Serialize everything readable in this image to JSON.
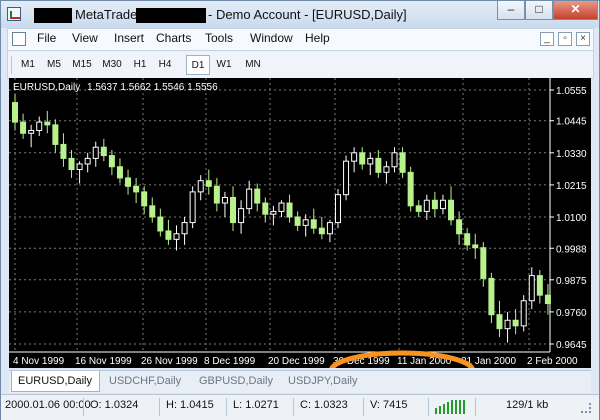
{
  "window": {
    "title": "MetaTrader",
    "subtitle": "- Demo Account - [EURUSD,Daily]",
    "controls": [
      "–",
      "□",
      "✕"
    ]
  },
  "menu": [
    "File",
    "View",
    "Insert",
    "Charts",
    "Tools",
    "Window",
    "Help"
  ],
  "mdi_controls": [
    "_",
    "▫",
    "×"
  ],
  "toolbar": {
    "timeframes": [
      "M1",
      "M5",
      "M15",
      "M30",
      "H1",
      "H4",
      "D1",
      "W1",
      "MN"
    ],
    "active": "D1"
  },
  "chart": {
    "symbol_label": "EURUSD,Daily",
    "ohlc": "1.5637 1.5662 1.5546 1.5556",
    "price_axis": [
      "1.0555",
      "1.0445",
      "1.0330",
      "1.0215",
      "1.0100",
      "0.9988",
      "0.9875",
      "0.9760",
      "0.9645"
    ],
    "date_axis": [
      "4 Nov 1999",
      "16 Nov 1999",
      "26 Nov 1999",
      "8 Dec 1999",
      "20 Dec 1999",
      "30 Dec 1999",
      "11 Jan 2000",
      "21 Jan 2000",
      "2 Feb 2000"
    ],
    "colors": {
      "background": "#000000",
      "bull": "#ffffff",
      "bear": "#b7f28d",
      "grid": "#7a7a7a",
      "highlight": "#f7931e"
    }
  },
  "chart_data": {
    "type": "candlestick",
    "y_axis_range": [
      0.9645,
      1.0555
    ],
    "x": [
      "4 Nov 1999",
      "16 Nov 1999",
      "26 Nov 1999",
      "8 Dec 1999",
      "20 Dec 1999",
      "30 Dec 1999",
      "11 Jan 2000",
      "21 Jan 2000",
      "2 Feb 2000"
    ],
    "candles": [
      [
        1.051,
        1.054,
        1.041,
        1.044
      ],
      [
        1.044,
        1.047,
        1.038,
        1.04
      ],
      [
        1.04,
        1.043,
        1.035,
        1.041
      ],
      [
        1.041,
        1.046,
        1.039,
        1.044
      ],
      [
        1.044,
        1.048,
        1.04,
        1.043
      ],
      [
        1.043,
        1.045,
        1.033,
        1.036
      ],
      [
        1.036,
        1.04,
        1.028,
        1.031
      ],
      [
        1.031,
        1.034,
        1.024,
        1.027
      ],
      [
        1.027,
        1.03,
        1.022,
        1.029
      ],
      [
        1.029,
        1.033,
        1.026,
        1.031
      ],
      [
        1.031,
        1.037,
        1.028,
        1.035
      ],
      [
        1.035,
        1.038,
        1.03,
        1.032
      ],
      [
        1.032,
        1.034,
        1.025,
        1.028
      ],
      [
        1.028,
        1.031,
        1.022,
        1.024
      ],
      [
        1.024,
        1.027,
        1.018,
        1.021
      ],
      [
        1.021,
        1.024,
        1.015,
        1.019
      ],
      [
        1.019,
        1.021,
        1.011,
        1.014
      ],
      [
        1.014,
        1.017,
        1.008,
        1.01
      ],
      [
        1.01,
        1.013,
        1.003,
        1.005
      ],
      [
        1.005,
        1.009,
        1.0,
        1.002
      ],
      [
        1.002,
        1.007,
        0.998,
        1.004
      ],
      [
        1.004,
        1.01,
        1.0,
        1.008
      ],
      [
        1.008,
        1.021,
        1.006,
        1.019
      ],
      [
        1.019,
        1.025,
        1.016,
        1.023
      ],
      [
        1.023,
        1.027,
        1.018,
        1.021
      ],
      [
        1.021,
        1.024,
        1.012,
        1.015
      ],
      [
        1.015,
        1.019,
        1.01,
        1.017
      ],
      [
        1.017,
        1.021,
        1.005,
        1.008
      ],
      [
        1.008,
        1.016,
        1.004,
        1.013
      ],
      [
        1.013,
        1.023,
        1.011,
        1.02
      ],
      [
        1.02,
        1.022,
        1.012,
        1.015
      ],
      [
        1.015,
        1.017,
        1.008,
        1.011
      ],
      [
        1.011,
        1.014,
        1.007,
        1.012
      ],
      [
        1.012,
        1.016,
        1.01,
        1.015
      ],
      [
        1.015,
        1.018,
        1.008,
        1.01
      ],
      [
        1.01,
        1.012,
        1.005,
        1.007
      ],
      [
        1.007,
        1.011,
        1.003,
        1.009
      ],
      [
        1.009,
        1.013,
        1.004,
        1.006
      ],
      [
        1.006,
        1.01,
        1.002,
        1.004
      ],
      [
        1.004,
        1.009,
        1.001,
        1.008
      ],
      [
        1.008,
        1.02,
        1.006,
        1.018
      ],
      [
        1.018,
        1.032,
        1.016,
        1.03
      ],
      [
        1.03,
        1.035,
        1.026,
        1.033
      ],
      [
        1.033,
        1.035,
        1.027,
        1.029
      ],
      [
        1.029,
        1.033,
        1.025,
        1.031
      ],
      [
        1.031,
        1.034,
        1.024,
        1.026
      ],
      [
        1.026,
        1.03,
        1.022,
        1.028
      ],
      [
        1.028,
        1.035,
        1.026,
        1.033
      ],
      [
        1.033,
        1.035,
        1.024,
        1.026
      ],
      [
        1.026,
        1.028,
        1.012,
        1.014
      ],
      [
        1.014,
        1.016,
        1.01,
        1.012
      ],
      [
        1.012,
        1.018,
        1.009,
        1.016
      ],
      [
        1.016,
        1.019,
        1.01,
        1.013
      ],
      [
        1.013,
        1.018,
        1.011,
        1.016
      ],
      [
        1.016,
        1.021,
        1.007,
        1.009
      ],
      [
        1.009,
        1.012,
        1.0,
        1.004
      ],
      [
        1.004,
        1.006,
        0.998,
        1.0
      ],
      [
        1.0,
        1.004,
        0.995,
        0.999
      ],
      [
        0.999,
        1.001,
        0.985,
        0.988
      ],
      [
        0.988,
        0.99,
        0.972,
        0.975
      ],
      [
        0.975,
        0.98,
        0.967,
        0.97
      ],
      [
        0.97,
        0.976,
        0.965,
        0.973
      ],
      [
        0.973,
        0.977,
        0.968,
        0.971
      ],
      [
        0.971,
        0.982,
        0.969,
        0.98
      ],
      [
        0.98,
        0.992,
        0.977,
        0.989
      ],
      [
        0.989,
        0.991,
        0.979,
        0.982
      ],
      [
        0.982,
        0.986,
        0.975,
        0.979
      ]
    ]
  },
  "tabs": [
    "EURUSD,Daily",
    "USDCHF,Daily",
    "GBPUSD,Daily",
    "USDJPY,Daily"
  ],
  "status": {
    "datetime": "2000.01.06 00:00",
    "open": "O: 1.0324",
    "high": "H: 1.0415",
    "low": "L: 1.0271",
    "close": "C: 1.0323",
    "volume": "V: 7415",
    "traffic": "129/1 kb"
  }
}
